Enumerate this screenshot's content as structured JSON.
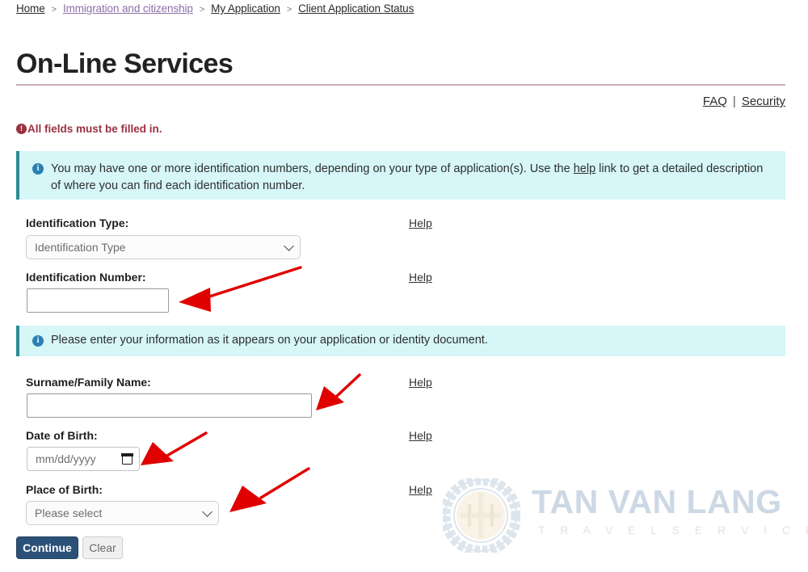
{
  "breadcrumb": {
    "items": [
      {
        "label": "Home",
        "visited": false
      },
      {
        "label": "Immigration and citizenship",
        "visited": true
      },
      {
        "label": "My Application",
        "visited": false
      },
      {
        "label": "Client Application Status",
        "visited": false
      }
    ],
    "separator": ">"
  },
  "header": {
    "title": "On-Line Services",
    "rule_color": "#c9aeb1"
  },
  "util_links": {
    "faq": "FAQ",
    "divider": "|",
    "security": "Security"
  },
  "required_note": {
    "icon": "exclamation-circle-icon",
    "text": "All fields must be filled in.",
    "color": "#9b3040"
  },
  "alerts": [
    {
      "icon": "info-circle-icon",
      "text_before": "You may have one or more identification numbers, depending on your type of application(s). Use the ",
      "link": "help",
      "text_after": " link to get a detailed description of where you can find each identification number.",
      "bg": "#d6f6f8",
      "accent": "#2b8b96"
    },
    {
      "icon": "info-circle-icon",
      "text": "Please enter your information as it appears on your application or identity document.",
      "bg": "#d6f6f8",
      "accent": "#2b8b96"
    }
  ],
  "form": {
    "help_label": "Help",
    "fields": [
      {
        "label": "Identification Type:",
        "type": "select",
        "value": "Identification Type",
        "help": "Help"
      },
      {
        "label": "Identification Number:",
        "type": "text",
        "value": "",
        "help": "Help"
      },
      {
        "label": "Surname/Family Name:",
        "type": "text",
        "value": "",
        "help": "Help"
      },
      {
        "label": "Date of Birth:",
        "type": "date",
        "value": "mm/dd/yyyy",
        "help": "Help"
      },
      {
        "label": "Place of Birth:",
        "type": "select",
        "value": "Please select",
        "help": "Help"
      }
    ]
  },
  "buttons": {
    "continue": "Continue",
    "clear": "Clear",
    "primary_color": "#2c5178"
  },
  "annotations": {
    "arrow_color": "#e00000",
    "count": 4
  },
  "watermark": {
    "brand": "TAN VAN LANG",
    "tagline": "T R A V E L   S E R V I C E",
    "logo": "circular-meander-logo"
  }
}
